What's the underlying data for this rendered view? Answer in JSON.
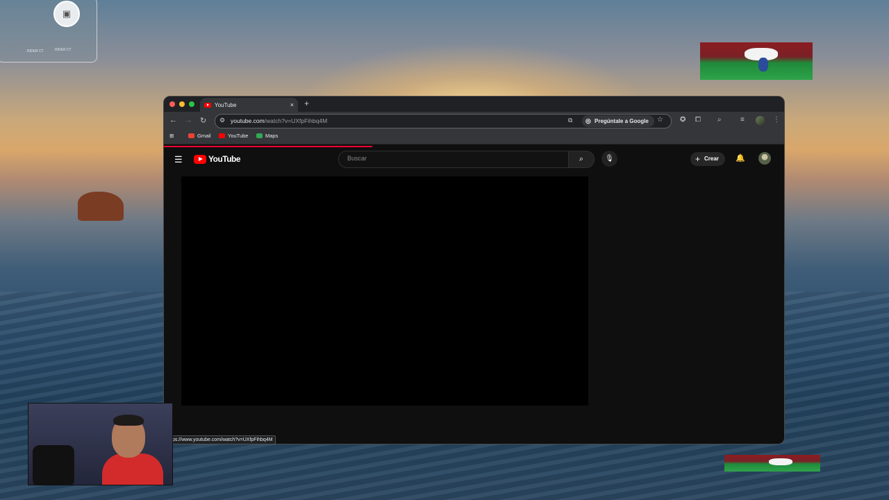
{
  "desktop": {
    "map_widget": {
      "road1": "RIDER CT",
      "road2": "RIDER CT"
    }
  },
  "browser": {
    "tab": {
      "title": "YouTube",
      "close": "×"
    },
    "new_tab": "+",
    "address": {
      "host": "youtube.com",
      "path": "/watch?v=UXfpFihbq4M"
    },
    "ask_google": "Pregúntale a Google",
    "bookmarks": [
      {
        "label": "Gmail",
        "color": "#ea4335"
      },
      {
        "label": "YouTube",
        "color": "#ff0000"
      },
      {
        "label": "Maps",
        "color": "#34a853"
      }
    ],
    "status_url": "ps://www.youtube.com/watch?v=UXfpFihbq4M"
  },
  "youtube": {
    "logo_text": "YouTube",
    "search_placeholder": "Buscar",
    "create_label": "Crear"
  },
  "colors": {
    "accent": "#ff0000",
    "background": "#0f0f0f"
  }
}
